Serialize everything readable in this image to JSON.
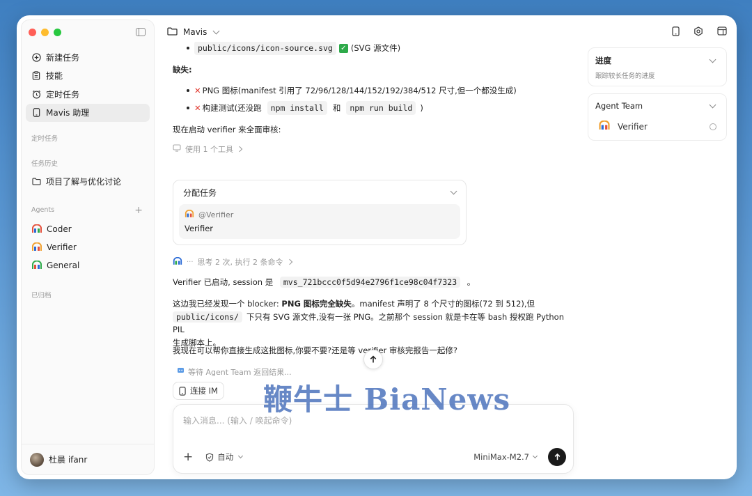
{
  "sidebar": {
    "nav": [
      {
        "label": "新建任务",
        "icon": "plus-circle-icon"
      },
      {
        "label": "技能",
        "icon": "clipboard-icon"
      },
      {
        "label": "定时任务",
        "icon": "alarm-clock-icon"
      },
      {
        "label": "Mavis 助理",
        "icon": "phone-icon"
      }
    ],
    "scheduled_label": "定时任务",
    "history_label": "任务历史",
    "history_items": [
      "项目了解与优化讨论"
    ],
    "agents_label": "Agents",
    "agents": [
      "Coder",
      "Verifier",
      "General"
    ],
    "archived_label": "已归档",
    "user_name": "杜晨 ifanr"
  },
  "topbar": {
    "project": "Mavis"
  },
  "chat": {
    "top_code": "public/icons/icon-source.svg",
    "top_note": "(SVG 源文件)",
    "missing_label": "缺失:",
    "missing_1_prefix": "PNG 图标(manifest 引用了 72/96/128/144/152/192/384/512 尺寸,但一个都没生成)",
    "missing_2_prefix": "构建测试(还没跑",
    "missing_2_code_a": "npm install",
    "missing_2_and": "和",
    "missing_2_code_b": "npm run build",
    "missing_2_suffix": ")",
    "start_verifier": "现在启动 verifier 来全面审核:",
    "tools_used": "使用 1 个工具",
    "assign_card": {
      "title": "分配任务",
      "mention": "@Verifier",
      "body": "Verifier"
    },
    "thinking": "思考 2 次, 执行 2 条命令",
    "verifier_started_a": "Verifier 已启动, session 是",
    "session_id": "mvs_721bccc0f5d94e2796f1ce98c04f7323",
    "verifier_started_b": "。",
    "p2_a": "这边我已经发现一个 blocker: ",
    "p2_bold": "PNG 图标完全缺失",
    "p2_b": "。manifest 声明了 8 个尺寸的图标(72 到 512),但",
    "p2_code": "public/icons/",
    "p2_c": "下只有 SVG 源文件,没有一张 PNG。之前那个 session 就是卡在等 bash 授权跑 Python PIL",
    "p2_d": "生成脚本上。",
    "p3": "我现在可以帮你直接生成这批图标,你要不要?还是等 verifier 审核完报告一起修?",
    "waiting": "等待 Agent Team 返回结果..."
  },
  "connect_im": "连接 IM",
  "composer": {
    "placeholder": "输入消息... (输入 / 唤起命令)",
    "mode": "自动",
    "model": "MiniMax-M2.7"
  },
  "progress_panel": {
    "title": "进度",
    "subtitle": "跟踪较长任务的进度"
  },
  "agent_team_panel": {
    "title": "Agent Team",
    "member": "Verifier"
  },
  "watermark": "鞭牛士 BiaNews",
  "colors": {
    "close": "#ff5f57",
    "minimize": "#febc2e",
    "maximize": "#28c840",
    "error": "#e0352b",
    "success": "#2eaa4a"
  }
}
